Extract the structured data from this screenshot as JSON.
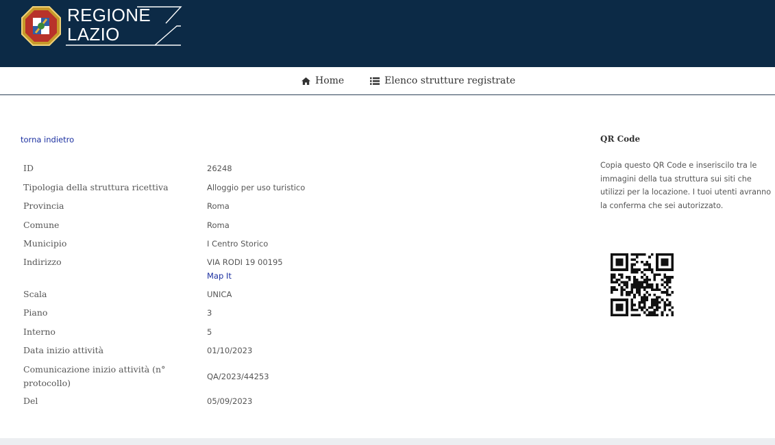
{
  "brand": {
    "line1": "REGIONE",
    "line2": "LAZIO",
    "header_color": "#0c2a46"
  },
  "nav": {
    "home": {
      "label": "Home",
      "icon": "home-icon"
    },
    "list": {
      "label": "Elenco strutture registrate",
      "icon": "list-icon"
    }
  },
  "back_link": "torna indietro",
  "details": [
    {
      "label": "ID",
      "value": "26248"
    },
    {
      "label": "Tipologia della struttura ricettiva",
      "value": "Alloggio per uso turistico"
    },
    {
      "label": "Provincia",
      "value": "Roma"
    },
    {
      "label": "Comune",
      "value": "Roma"
    },
    {
      "label": "Municipio",
      "value": "I Centro Storico"
    },
    {
      "label": "Indirizzo",
      "value": "VIA RODI 19 00195",
      "link": "Map It"
    },
    {
      "label": "Scala",
      "value": "UNICA"
    },
    {
      "label": "Piano",
      "value": "3"
    },
    {
      "label": "Interno",
      "value": "5"
    },
    {
      "label": "Data inizio attività",
      "value": "01/10/2023"
    },
    {
      "label": "Comunicazione inizio attività (n° protocollo)",
      "value": "QA/2023/44253"
    },
    {
      "label": "Del",
      "value": "05/09/2023"
    }
  ],
  "qr": {
    "title": "QR Code",
    "description": "Copia questo QR Code e inseriscilo tra le immagini della tua struttura sui siti che utilizzi per la locazione. I tuoi utenti avranno la conferma che sei autorizzato."
  }
}
